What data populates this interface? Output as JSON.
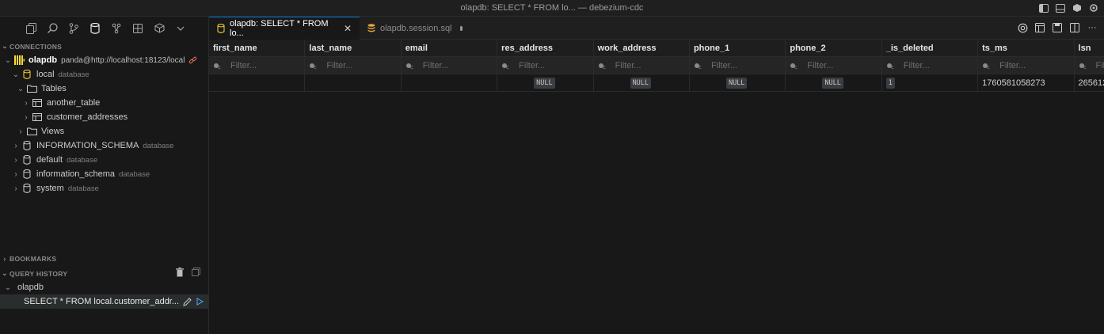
{
  "window": {
    "title": "olapdb: SELECT * FROM lo... — debezium-cdc"
  },
  "sidebar": {
    "connections_header": "CONNECTIONS",
    "connection": {
      "name": "olapdb",
      "url": "panda@http://localhost:18123/local"
    },
    "tree": [
      {
        "label": "local",
        "sub": "database"
      },
      {
        "label": "Tables"
      },
      {
        "label": "another_table"
      },
      {
        "label": "customer_addresses"
      },
      {
        "label": "Views"
      },
      {
        "label": "INFORMATION_SCHEMA",
        "sub": "database"
      },
      {
        "label": "default",
        "sub": "database"
      },
      {
        "label": "information_schema",
        "sub": "database"
      },
      {
        "label": "system",
        "sub": "database"
      }
    ],
    "bookmarks_header": "BOOKMARKS",
    "history_header": "QUERY HISTORY",
    "history_group": "olapdb",
    "history_item": "SELECT * FROM local.customer_addr..."
  },
  "tabs": [
    {
      "label": "olapdb: SELECT * FROM lo...",
      "active": true
    },
    {
      "label": "olapdb.session.sql",
      "active": false
    }
  ],
  "grid": {
    "columns": [
      "first_name",
      "last_name",
      "email",
      "res_address",
      "work_address",
      "phone_1",
      "phone_2",
      "_is_deleted",
      "ts_ms",
      "lsn"
    ],
    "filter_placeholder": "Filter...",
    "filter_placeholder_short": "Fil",
    "rows": [
      [
        "",
        "",
        "",
        "NULL",
        "NULL",
        "NULL",
        "NULL",
        "1",
        "1760581058273",
        "265612"
      ]
    ]
  }
}
